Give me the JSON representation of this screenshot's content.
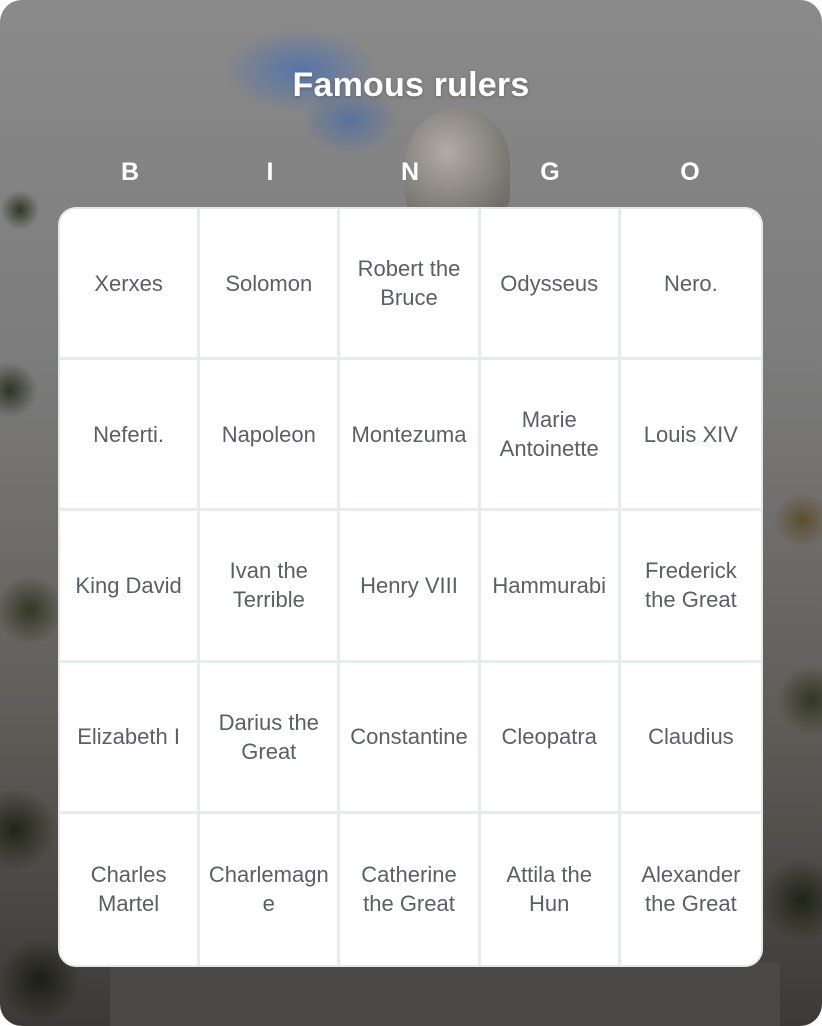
{
  "title": "Famous rulers",
  "header_letters": [
    "B",
    "I",
    "N",
    "G",
    "O"
  ],
  "board": {
    "rows": [
      [
        "Xerxes",
        "Solomon",
        "Robert the Bruce",
        "Odysseus",
        "Nero."
      ],
      [
        "Neferti.",
        "Napoleon",
        "Montezuma",
        "Marie Antoinette",
        "Louis XIV"
      ],
      [
        "King David",
        "Ivan the Terrible",
        "Henry VIII",
        "Hammurabi",
        "Frederick the Great"
      ],
      [
        "Elizabeth I",
        "Darius the Great",
        "Constantine",
        "Cleopatra",
        "Claudius"
      ],
      [
        "Charles Martel",
        "Charlemagne",
        "Catherine the Great",
        "Attila the Hun",
        "Alexander the Great"
      ]
    ]
  },
  "colors": {
    "title_text": "#ffffff",
    "cell_text": "#5a5f63",
    "grid_line": "#e8ebec",
    "board_bg": "#ffffff"
  }
}
